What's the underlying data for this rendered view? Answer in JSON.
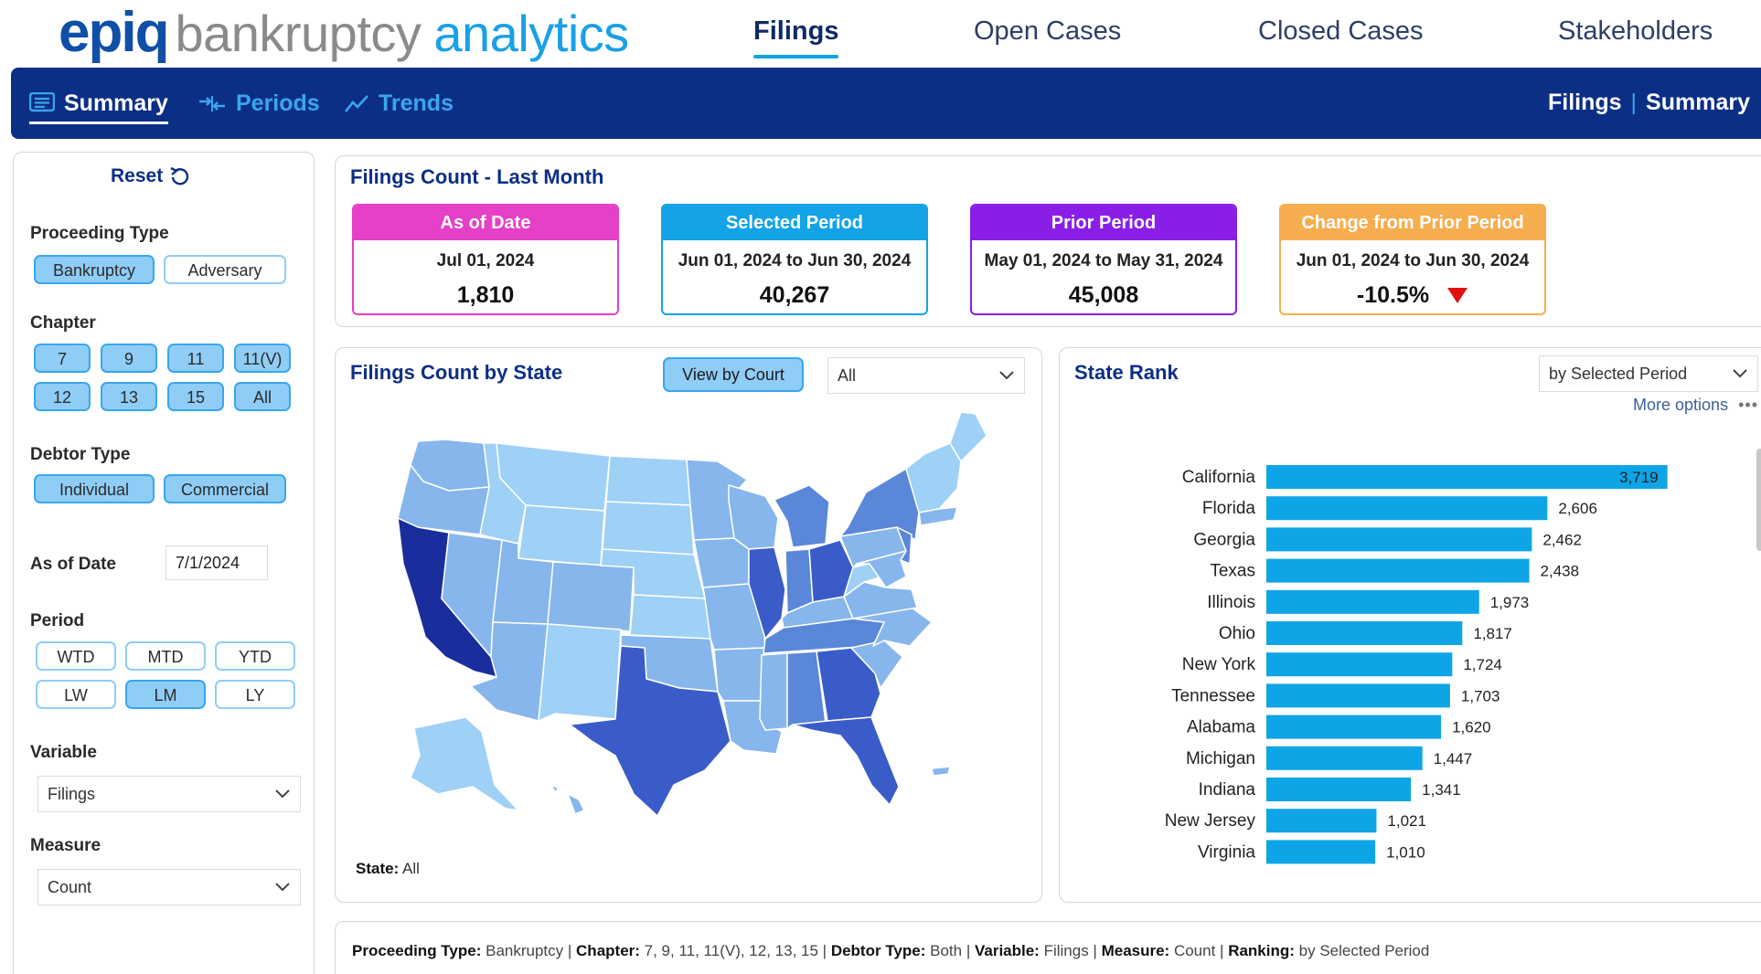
{
  "brand": {
    "part1": "epiq",
    "part2": "bankruptcy",
    "part3": "analytics"
  },
  "top_nav": [
    {
      "label": "Filings",
      "active": true
    },
    {
      "label": "Open Cases",
      "active": false
    },
    {
      "label": "Closed Cases",
      "active": false
    },
    {
      "label": "Stakeholders",
      "active": false
    }
  ],
  "sub_nav": [
    {
      "label": "Summary",
      "icon": "list-icon",
      "active": true
    },
    {
      "label": "Periods",
      "icon": "periods-icon",
      "active": false
    },
    {
      "label": "Trends",
      "icon": "trend-line-icon",
      "active": false
    }
  ],
  "breadcrumb": {
    "section": "Filings",
    "separator": "|",
    "page": "Summary"
  },
  "filters": {
    "reset_label": "Reset",
    "proceeding_type": {
      "label": "Proceeding Type",
      "options": [
        {
          "label": "Bankruptcy",
          "selected": true
        },
        {
          "label": "Adversary",
          "selected": false
        }
      ]
    },
    "chapter": {
      "label": "Chapter",
      "options": [
        {
          "label": "7",
          "selected": true
        },
        {
          "label": "9",
          "selected": true
        },
        {
          "label": "11",
          "selected": true
        },
        {
          "label": "11(V)",
          "selected": true
        },
        {
          "label": "12",
          "selected": true
        },
        {
          "label": "13",
          "selected": true
        },
        {
          "label": "15",
          "selected": true
        },
        {
          "label": "All",
          "selected": true
        }
      ]
    },
    "debtor_type": {
      "label": "Debtor Type",
      "options": [
        {
          "label": "Individual",
          "selected": true
        },
        {
          "label": "Commercial",
          "selected": true
        }
      ]
    },
    "as_of_date": {
      "label": "As of Date",
      "value": "7/1/2024"
    },
    "period": {
      "label": "Period",
      "options": [
        {
          "label": "WTD",
          "selected": false
        },
        {
          "label": "MTD",
          "selected": false
        },
        {
          "label": "YTD",
          "selected": false
        },
        {
          "label": "LW",
          "selected": false
        },
        {
          "label": "LM",
          "selected": true
        },
        {
          "label": "LY",
          "selected": false
        }
      ]
    },
    "variable": {
      "label": "Variable",
      "value": "Filings"
    },
    "measure": {
      "label": "Measure",
      "value": "Count"
    }
  },
  "kpi_panel": {
    "title": "Filings Count - Last Month",
    "cards": [
      {
        "header": "As of Date",
        "date": "Jul 01, 2024",
        "value": "1,810",
        "color": "#e63fc8"
      },
      {
        "header": "Selected Period",
        "date": "Jun 01, 2024 to Jun 30, 2024",
        "value": "40,267",
        "color": "#13a3e6"
      },
      {
        "header": "Prior Period",
        "date": "May 01, 2024 to May 31, 2024",
        "value": "45,008",
        "color": "#8a1ee6"
      },
      {
        "header": "Change from Prior Period",
        "date": "Jun 01, 2024 to Jun 30, 2024",
        "value": "-10.5%",
        "color": "#f6ad4e",
        "trend": "down"
      }
    ]
  },
  "map_panel": {
    "title": "Filings Count by State",
    "view_button": "View by Court",
    "state_select": "All",
    "footer_label": "State:",
    "footer_value": "All",
    "colors": {
      "darkest": "#1a2d9c",
      "dark": "#3a5cc8",
      "mid": "#5b87d8",
      "light": "#86b6ec",
      "lightest": "#9fd0f6"
    }
  },
  "rank_panel": {
    "title": "State Rank",
    "ranking_select": "by Selected Period",
    "more_options": "More options",
    "bar_color": "#0ea5e6"
  },
  "chart_data": {
    "type": "bar",
    "orientation": "horizontal",
    "categories": [
      "California",
      "Florida",
      "Georgia",
      "Texas",
      "Illinois",
      "Ohio",
      "New York",
      "Tennessee",
      "Alabama",
      "Michigan",
      "Indiana",
      "New Jersey",
      "Virginia"
    ],
    "values": [
      3719,
      2606,
      2462,
      2438,
      1973,
      1817,
      1724,
      1703,
      1620,
      1447,
      1341,
      1021,
      1010
    ],
    "labels": [
      "3,719",
      "2,606",
      "2,462",
      "2,438",
      "1,973",
      "1,817",
      "1,724",
      "1,703",
      "1,620",
      "1,447",
      "1,341",
      "1,021",
      "1,010"
    ],
    "title": "State Rank",
    "xlim": [
      0,
      3900
    ]
  },
  "summary_bar": [
    {
      "label": "Proceeding Type:",
      "value": "Bankruptcy"
    },
    {
      "label": "Chapter:",
      "value": "7, 9, 11, 11(V), 12, 13, 15"
    },
    {
      "label": "Debtor Type:",
      "value": "Both"
    },
    {
      "label": "Variable:",
      "value": "Filings"
    },
    {
      "label": "Measure:",
      "value": "Count"
    },
    {
      "label": "Ranking:",
      "value": "by Selected Period"
    }
  ]
}
